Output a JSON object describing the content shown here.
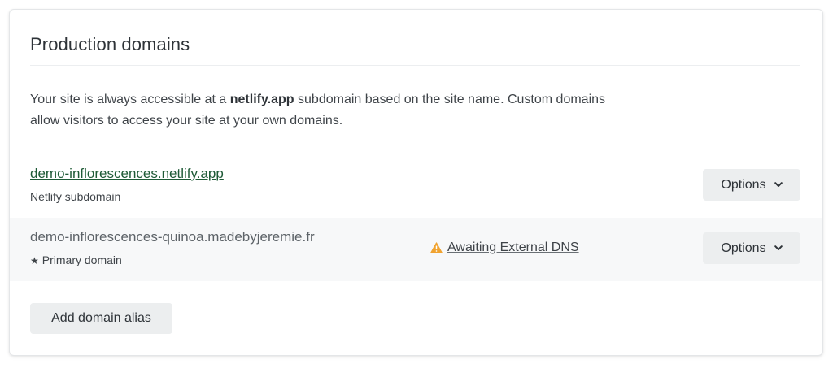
{
  "section": {
    "title": "Production domains",
    "description_prefix": "Your site is always accessible at a ",
    "description_strong": "netlify.app",
    "description_suffix": " subdomain based on the site name. Custom domains allow visitors to access your site at your own domains."
  },
  "domains": [
    {
      "name": "demo-inflorescences.netlify.app",
      "subtitle": "Netlify subdomain",
      "options_label": "Options"
    },
    {
      "name": "demo-inflorescences-quinoa.madebyjeremie.fr",
      "subtitle": "Primary domain",
      "status": "Awaiting External DNS",
      "options_label": "Options"
    }
  ],
  "actions": {
    "add_alias_label": "Add domain alias"
  },
  "icons": {
    "warning": "warning-triangle-icon",
    "star": "star-icon",
    "chevron": "chevron-down-icon"
  },
  "colors": {
    "link": "#1e5a36",
    "warning": "#f0a330",
    "button_bg": "#eceeef",
    "row_alt_bg": "#f7f8f9"
  }
}
